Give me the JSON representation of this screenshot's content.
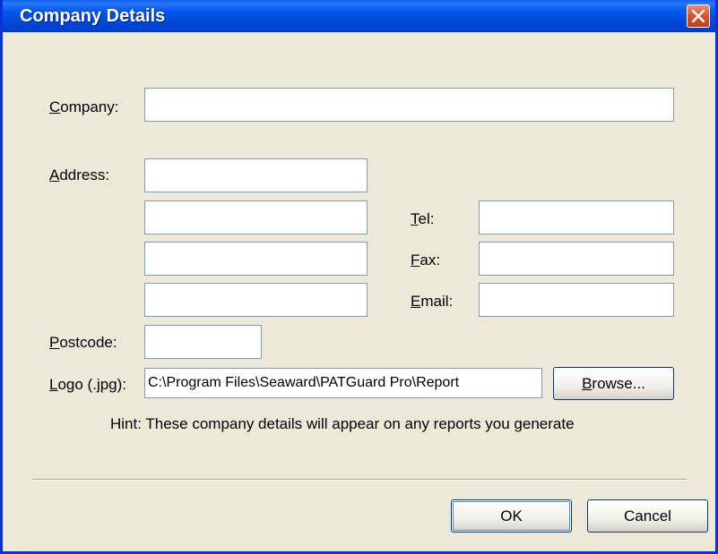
{
  "window": {
    "title": "Company Details",
    "close_label": "close"
  },
  "form": {
    "company": {
      "prefix": "",
      "accel": "C",
      "rest": "ompany:",
      "value": ""
    },
    "address": {
      "prefix": "",
      "accel": "A",
      "rest": "ddress:",
      "lines": [
        "",
        "",
        "",
        ""
      ]
    },
    "tel": {
      "prefix": "",
      "accel": "T",
      "rest": "el:",
      "value": ""
    },
    "fax": {
      "prefix": "",
      "accel": "F",
      "rest": "ax:",
      "value": ""
    },
    "email": {
      "prefix": "",
      "accel": "E",
      "rest": "mail:",
      "value": ""
    },
    "postcode": {
      "prefix": "",
      "accel": "P",
      "rest": "ostcode:",
      "value": ""
    },
    "logo": {
      "prefix": "",
      "accel": "L",
      "rest": "ogo (.jpg):",
      "value": "C:\\Program Files\\Seaward\\PATGuard Pro\\Report"
    },
    "browse": {
      "prefix": "",
      "accel": "B",
      "rest": "rowse..."
    }
  },
  "hint": "Hint: These company details will appear on any reports you generate",
  "buttons": {
    "ok": "OK",
    "cancel": "Cancel"
  },
  "icons": {
    "close": "close-icon"
  },
  "colors": {
    "titlebar": "#0058ee",
    "dialog_bg": "#ece9d8",
    "close_button": "#d9522b",
    "field_border": "#7f9db9"
  }
}
